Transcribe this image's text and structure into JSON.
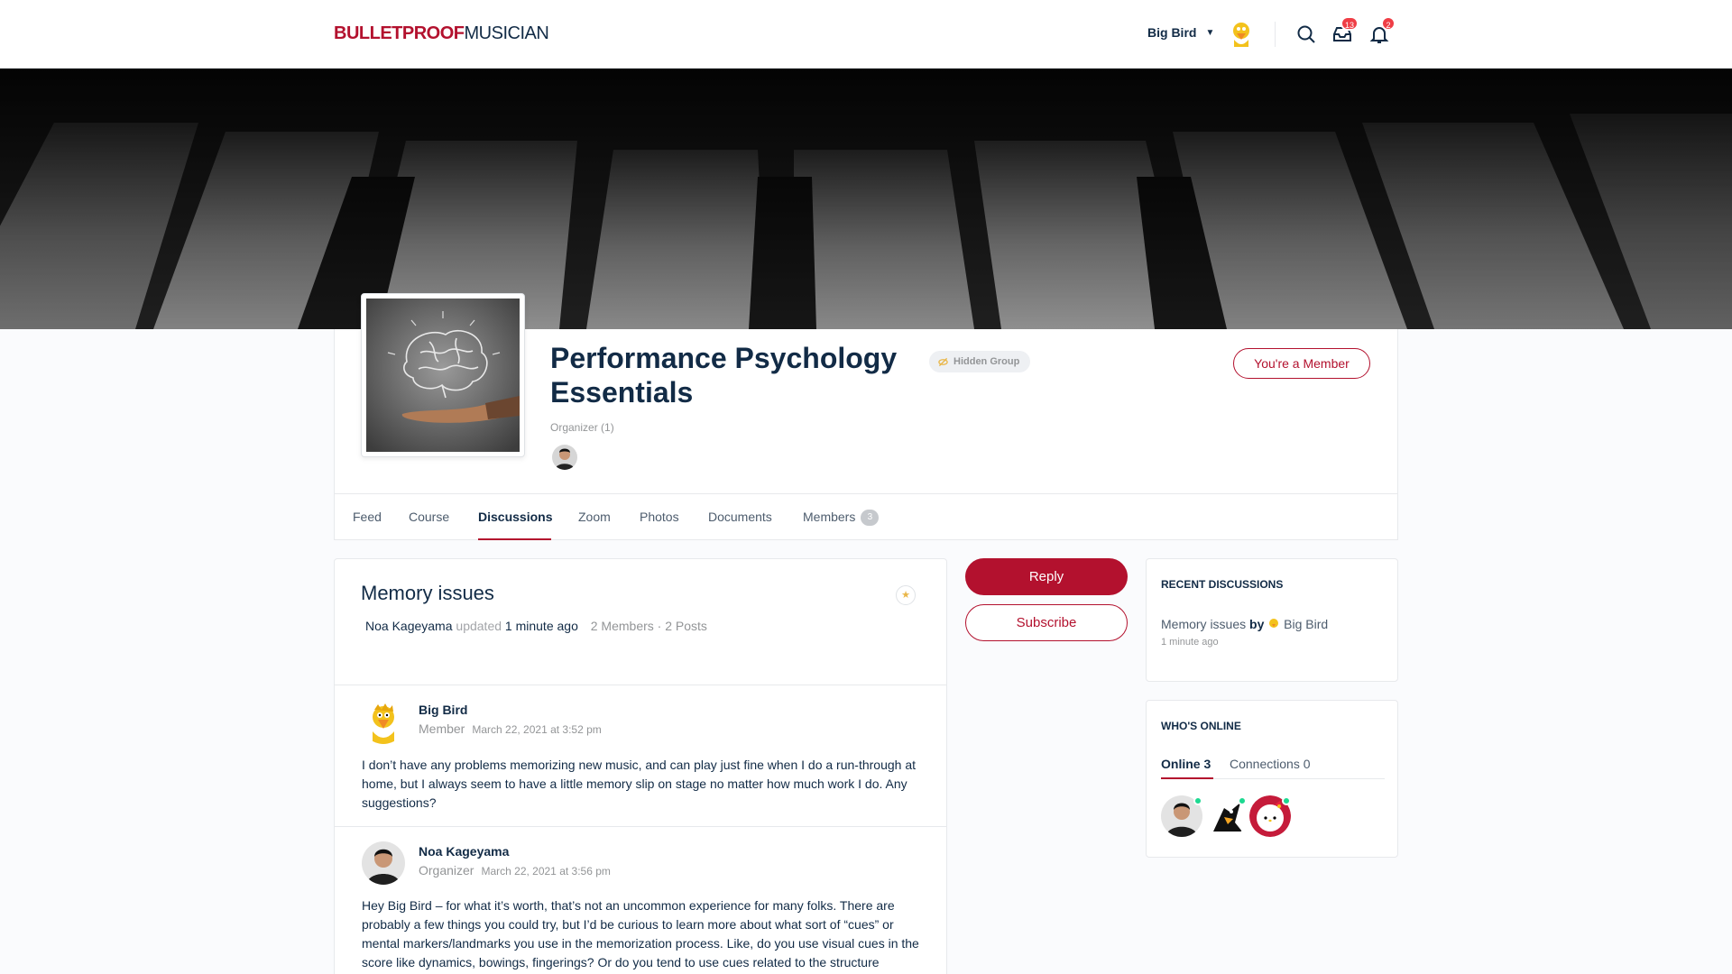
{
  "header": {
    "logo_part1": "BULLETPROOF",
    "logo_part2": "MUSICIAN",
    "user_name": "Big Bird",
    "messages_count": "13",
    "notifications_count": "2"
  },
  "group": {
    "title": "Performance Psychology Essentials",
    "privacy": "Hidden Group",
    "organizer_label": "Organizer (1)",
    "member_button": "You're a Member",
    "tabs": [
      {
        "label": "Feed"
      },
      {
        "label": "Course"
      },
      {
        "label": "Discussions"
      },
      {
        "label": "Zoom"
      },
      {
        "label": "Photos"
      },
      {
        "label": "Documents"
      },
      {
        "label": "Members",
        "count": "3"
      }
    ]
  },
  "discussion": {
    "title": "Memory issues",
    "author": "Noa Kageyama",
    "updated_word": "updated",
    "updated_time": "1 minute ago",
    "stats": "2 Members · 2 Posts",
    "posts": [
      {
        "name": "Big Bird",
        "role": "Member",
        "date": "March 22, 2021 at 3:52 pm",
        "body": "I don’t have any problems memorizing new music, and can play just fine when I do a run-through at home, but I always seem to have a little memory slip on stage no matter how much work I do. Any suggestions?"
      },
      {
        "name": "Noa Kageyama",
        "role": "Organizer",
        "date": "March 22, 2021 at 3:56 pm",
        "body": "Hey Big Bird – for what it’s worth, that’s not an uncommon experience for many folks. There are probably a few things you could try, but I’d be curious to learn more about what sort of “cues” or mental markers/landmarks you use in the memorization process. Like, do you use visual cues in the score like dynamics, bowings, fingerings? Or do you tend to use cues related to the structure"
      }
    ]
  },
  "actions": {
    "reply": "Reply",
    "subscribe": "Subscribe"
  },
  "recent_discussions": {
    "title": "Recent Discussions",
    "items": [
      {
        "topic": "Memory issues",
        "by": "by",
        "author": "Big Bird",
        "time": "1 minute ago"
      }
    ]
  },
  "whos_online": {
    "title": "Who's Online",
    "tab_online": "Online",
    "online_count": "3",
    "tab_connections": "Connections",
    "connections_count": "0"
  },
  "colors": {
    "brand": "#b3112e",
    "online_dot": "#1cd991",
    "badge": "#ef3e46"
  },
  "icons": [
    "search-icon",
    "inbox-icon",
    "bell-icon",
    "chevron-down-icon",
    "star-icon",
    "hidden-icon"
  ]
}
